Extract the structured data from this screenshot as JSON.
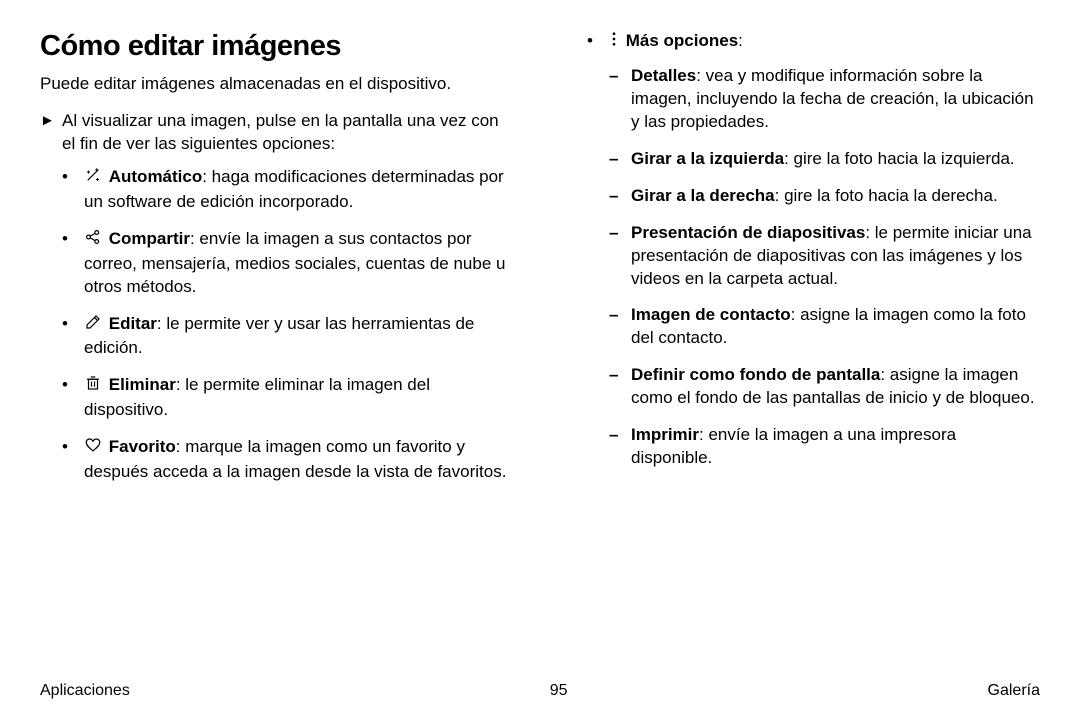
{
  "heading": "Cómo editar imágenes",
  "intro": "Puede editar imágenes almacenadas en el dispositivo.",
  "step": "Al visualizar una imagen, pulse en la pantalla una vez con el fin de ver las siguientes opciones:",
  "bullets": {
    "auto": {
      "label": "Automático",
      "text": ": haga modificaciones determinadas por un software de edición incorporado."
    },
    "share": {
      "label": "Compartir",
      "text": ": envíe la imagen a sus contactos por correo, mensajería, medios sociales, cuentas de nube u otros métodos."
    },
    "edit": {
      "label": "Editar",
      "text": ": le permite ver y usar las herramientas de edición."
    },
    "delete": {
      "label": "Eliminar",
      "text": ": le permite eliminar la imagen del dispositivo."
    },
    "favorite": {
      "label": "Favorito",
      "text": ": marque la imagen como un favorito y después acceda a la imagen desde la vista de favoritos."
    },
    "more": {
      "label": "Más opciones",
      "text": ":"
    }
  },
  "sub": {
    "details": {
      "label": "Detalles",
      "text": ": vea y modifique información sobre la imagen, incluyendo la fecha de creación, la ubicación y las propiedades."
    },
    "rotate_left": {
      "label": "Girar a la izquierda",
      "text": ": gire la foto hacia la izquierda."
    },
    "rotate_right": {
      "label": "Girar a la derecha",
      "text": ": gire la foto hacia la derecha."
    },
    "slideshow": {
      "label": "Presentación de diapositivas",
      "text": ": le permite iniciar una presentación de diapositivas con las imágenes y los videos en la carpeta actual."
    },
    "contact": {
      "label": "Imagen de contacto",
      "text": ": asigne la imagen como la foto del contacto."
    },
    "wallpaper": {
      "label": "Definir como fondo de pantalla",
      "text": ": asigne la imagen como el fondo de las pantallas de inicio y de bloqueo."
    },
    "print": {
      "label": "Imprimir",
      "text": ": envíe la imagen a una impresora disponible."
    }
  },
  "footer": {
    "left": "Aplicaciones",
    "center": "95",
    "right": "Galería"
  }
}
